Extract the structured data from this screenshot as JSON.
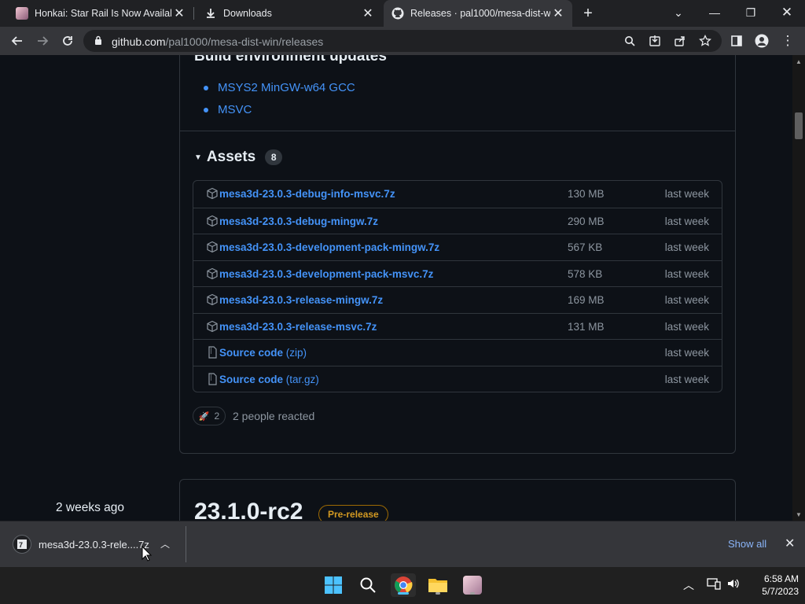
{
  "browser": {
    "tabs": [
      {
        "title": "Honkai: Star Rail Is Now Available",
        "icon": "honkai-favicon",
        "active": false
      },
      {
        "title": "Downloads",
        "icon": "download-icon",
        "active": false
      },
      {
        "title": "Releases · pal1000/mesa-dist-win",
        "icon": "github-icon",
        "active": true
      }
    ],
    "new_tab": "+",
    "url_host": "github.com",
    "url_path": "/pal1000/mesa-dist-win/releases"
  },
  "release": {
    "section_heading": "Build environment updates",
    "build_items": [
      "MSYS2 MinGW-w64 GCC",
      "MSVC"
    ],
    "assets_label": "Assets",
    "assets_count": "8",
    "assets": [
      {
        "name": "mesa3d-23.0.3-debug-info-msvc.7z",
        "ext": "",
        "size": "130 MB",
        "date": "last week",
        "icon": "package-icon"
      },
      {
        "name": "mesa3d-23.0.3-debug-mingw.7z",
        "ext": "",
        "size": "290 MB",
        "date": "last week",
        "icon": "package-icon"
      },
      {
        "name": "mesa3d-23.0.3-development-pack-mingw.7z",
        "ext": "",
        "size": "567 KB",
        "date": "last week",
        "icon": "package-icon"
      },
      {
        "name": "mesa3d-23.0.3-development-pack-msvc.7z",
        "ext": "",
        "size": "578 KB",
        "date": "last week",
        "icon": "package-icon"
      },
      {
        "name": "mesa3d-23.0.3-release-mingw.7z",
        "ext": "",
        "size": "169 MB",
        "date": "last week",
        "icon": "package-icon"
      },
      {
        "name": "mesa3d-23.0.3-release-msvc.7z",
        "ext": "",
        "size": "131 MB",
        "date": "last week",
        "icon": "package-icon"
      },
      {
        "name": "Source code",
        "ext": " (zip)",
        "size": "",
        "date": "last week",
        "icon": "file-zip-icon"
      },
      {
        "name": "Source code",
        "ext": " (tar.gz)",
        "size": "",
        "date": "last week",
        "icon": "file-zip-icon"
      }
    ],
    "reaction_emoji": "🚀",
    "reaction_count": "2",
    "reaction_text": "2 people reacted"
  },
  "next_release": {
    "date": "2 weeks ago",
    "title": "23.1.0-rc2",
    "badge": "Pre-release"
  },
  "download_shelf": {
    "file": "mesa3d-23.0.3-rele....7z",
    "show_all": "Show all"
  },
  "taskbar": {
    "time": "6:58 AM",
    "date": "5/7/2023"
  },
  "colors": {
    "link": "#4493f8",
    "prerelease": "#d29922",
    "bg": "#0d1117"
  }
}
